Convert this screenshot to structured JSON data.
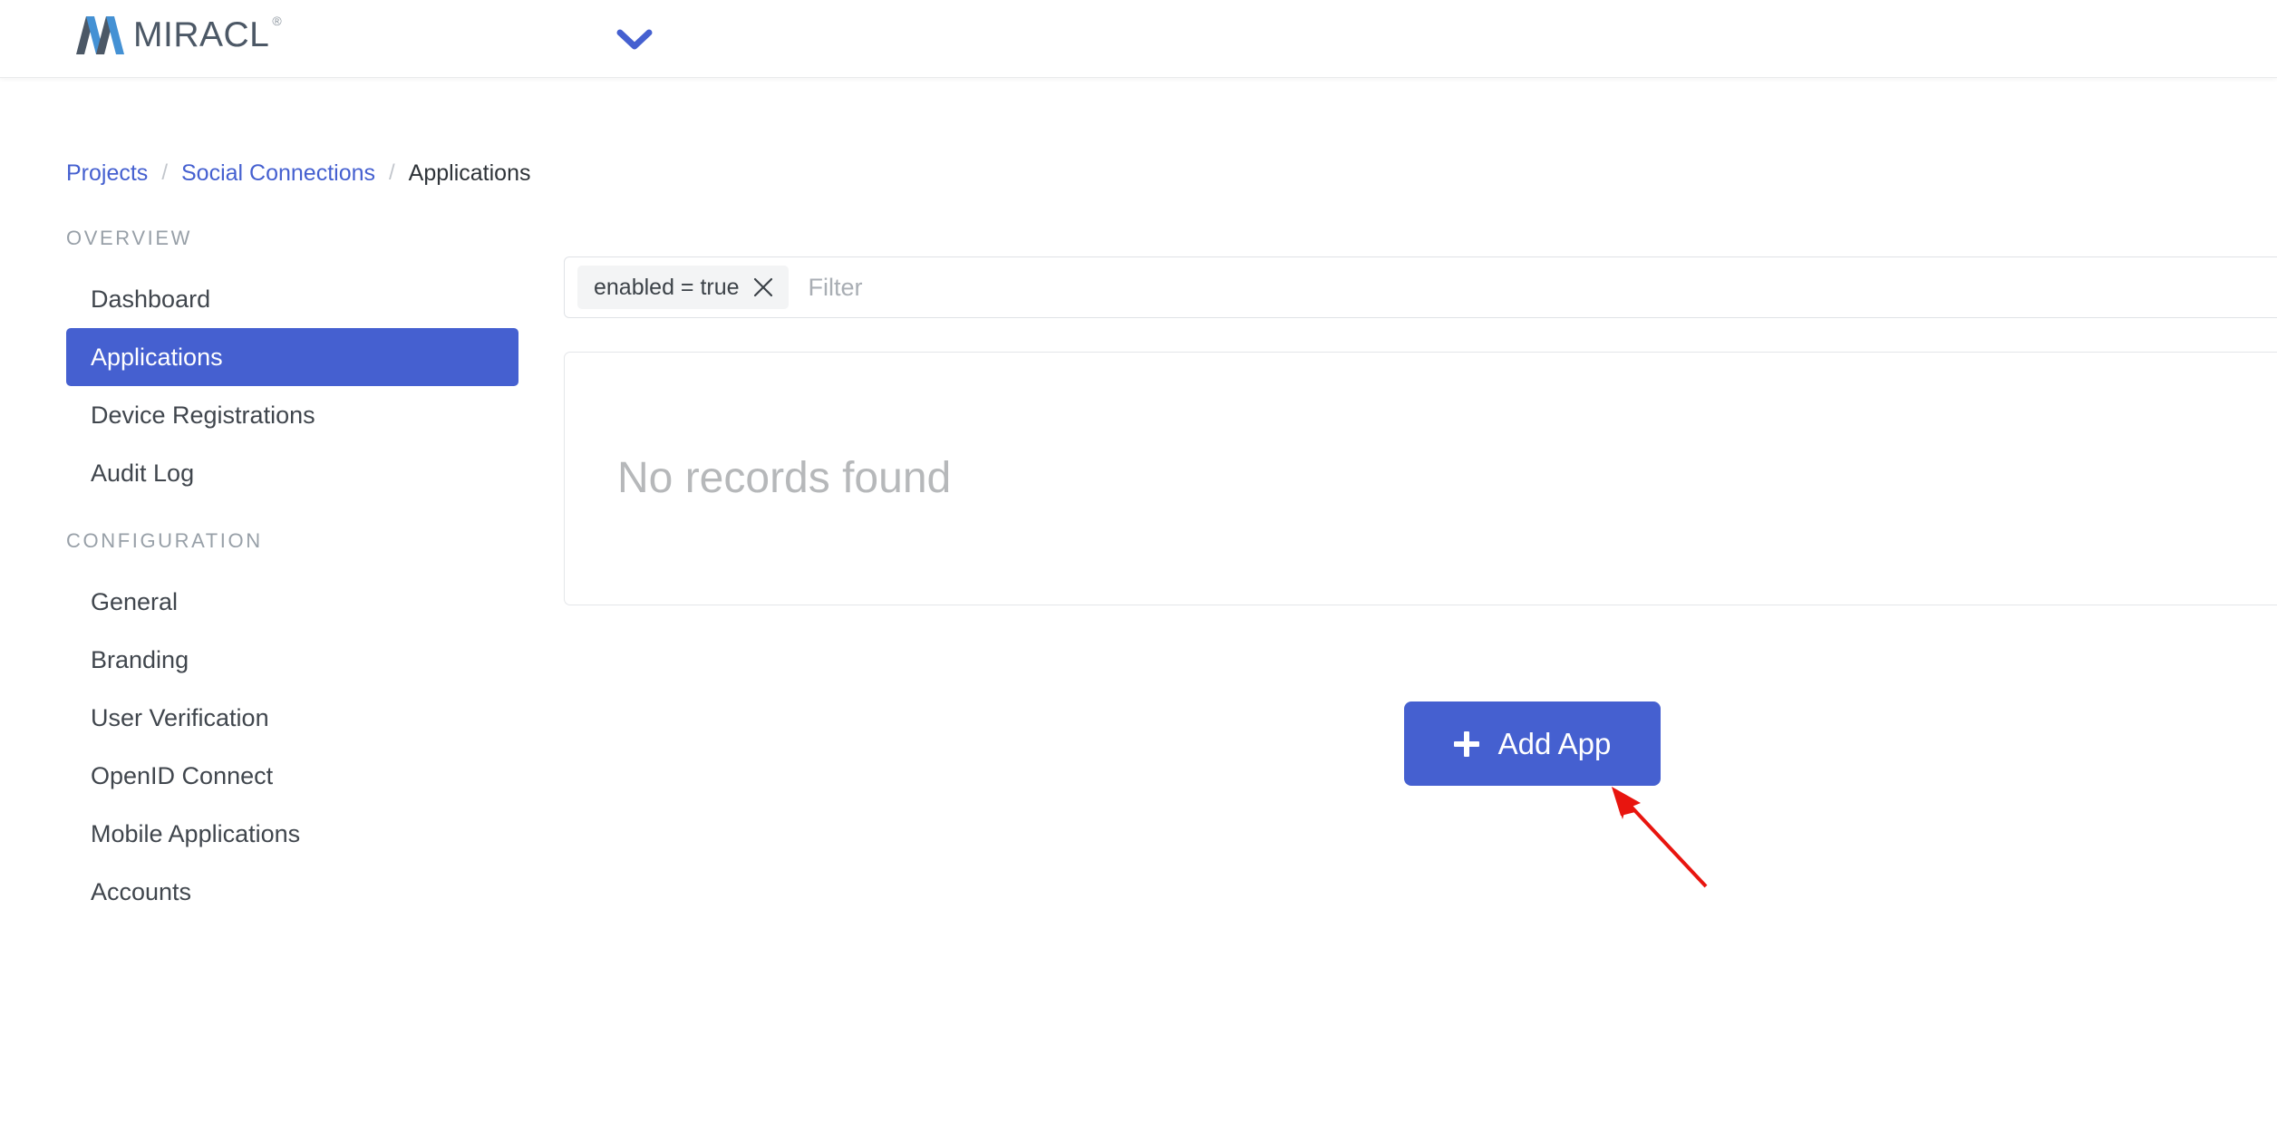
{
  "header": {
    "brand_name": "MIRACL",
    "brand_registered_mark": "®",
    "brand_logo_icon": "miracl-m-logo",
    "dropdown_icon": "chevron-down-icon"
  },
  "breadcrumb": {
    "items": [
      {
        "label": "Projects",
        "current": false
      },
      {
        "label": "Social Connections",
        "current": false
      },
      {
        "label": "Applications",
        "current": true
      }
    ],
    "separator": "/"
  },
  "sidebar": {
    "sections": [
      {
        "title": "OVERVIEW",
        "items": [
          {
            "label": "Dashboard",
            "active": false
          },
          {
            "label": "Applications",
            "active": true
          },
          {
            "label": "Device Registrations",
            "active": false
          },
          {
            "label": "Audit Log",
            "active": false
          }
        ]
      },
      {
        "title": "CONFIGURATION",
        "items": [
          {
            "label": "General",
            "active": false
          },
          {
            "label": "Branding",
            "active": false
          },
          {
            "label": "User Verification",
            "active": false
          },
          {
            "label": "OpenID Connect",
            "active": false
          },
          {
            "label": "Mobile Applications",
            "active": false
          },
          {
            "label": "Accounts",
            "active": false
          }
        ]
      }
    ]
  },
  "main": {
    "filter": {
      "chips": [
        {
          "label": "enabled = true",
          "remove_icon": "close-x-icon"
        }
      ],
      "input_value": "",
      "placeholder": "Filter"
    },
    "records": {
      "empty_message": "No records found"
    },
    "add_app_button": {
      "label": "Add App",
      "icon": "plus-icon"
    },
    "annotation": {
      "type": "arrow",
      "color": "#e8150f",
      "points_to": "add-app-button"
    }
  },
  "colors": {
    "accent_blue": "#4560d0",
    "link_blue": "#4560d0",
    "logo_blue": "#4491d4",
    "logo_slate": "#4c5866",
    "muted_text": "#98a0a8",
    "empty_text": "#b6b8ba",
    "annotation_red": "#e8150f"
  }
}
